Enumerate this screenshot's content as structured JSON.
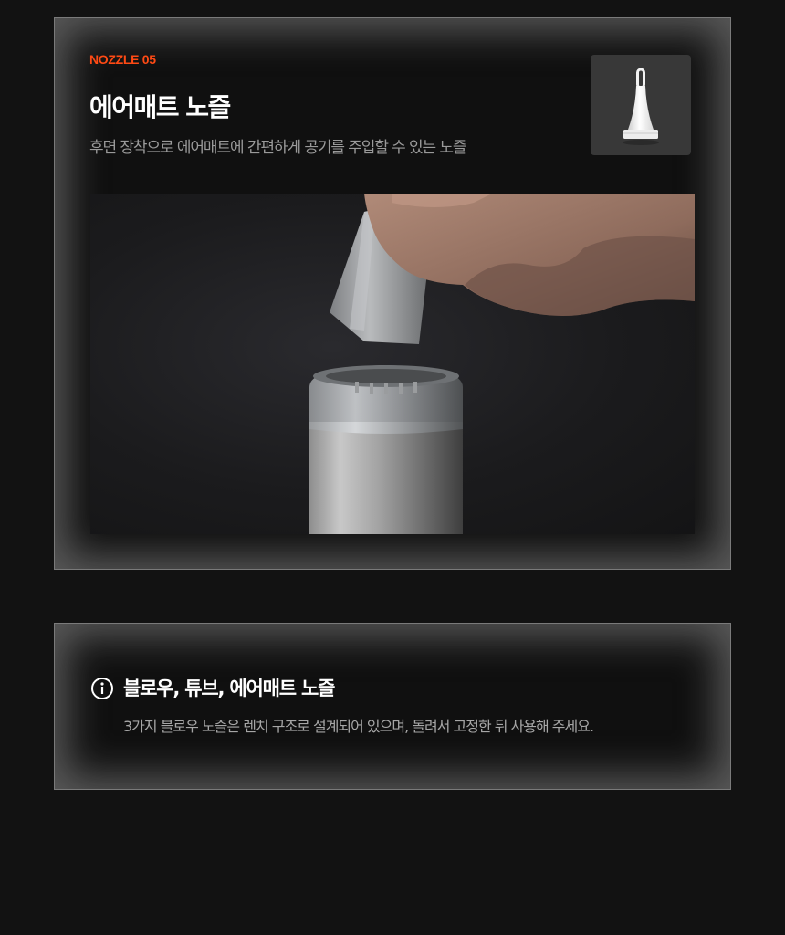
{
  "nozzle": {
    "eyebrow": "NOZZLE 05",
    "title": "에어매트 노즐",
    "description": "후면 장착으로 에어매트에 간편하게 공기를 주입할 수 있는 노즐",
    "thumbnail_icon": "air-mattress-nozzle-image",
    "photo_icon": "hand-attaching-nozzle-photo"
  },
  "notice": {
    "icon": "info-icon",
    "title": "블로우, 튜브, 에어매트 노즐",
    "text": "3가지 블로우 노즐은 렌치 구조로 설계되어 있으며, 돌려서 고정한 뒤 사용해 주세요."
  },
  "colors": {
    "background": "#121212",
    "accent": "#ff4a14",
    "card_border": "#7a7a7a",
    "muted_text": "#9a9a9a"
  }
}
